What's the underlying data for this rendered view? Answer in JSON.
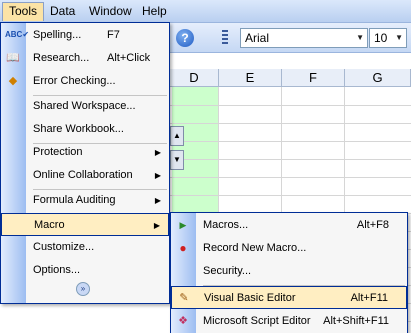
{
  "menubar": {
    "items": [
      {
        "label": "Tools",
        "active": true
      },
      {
        "label": "Data"
      },
      {
        "label": "Window"
      },
      {
        "label": "Help"
      }
    ]
  },
  "toolbar": {
    "help_icon": "?",
    "font_name": "Arial",
    "font_size": "10"
  },
  "grid": {
    "columns": [
      "D",
      "E",
      "F",
      "G"
    ]
  },
  "tools_menu": {
    "items": [
      {
        "label": "Spelling...",
        "shortcut": "F7",
        "icon": "spelling-icon"
      },
      {
        "label": "Research...",
        "shortcut": "Alt+Click",
        "icon": "research-icon"
      },
      {
        "label": "Error Checking...",
        "shortcut": "",
        "icon": "error-checking-icon"
      },
      {
        "label": "Shared Workspace...",
        "shortcut": ""
      },
      {
        "label": "Share Workbook...",
        "shortcut": ""
      },
      {
        "label": "Protection",
        "shortcut": "",
        "submenu": true
      },
      {
        "label": "Online Collaboration",
        "shortcut": "",
        "submenu": true
      },
      {
        "label": "Formula Auditing",
        "shortcut": "",
        "submenu": true
      },
      {
        "label": "Macro",
        "shortcut": "",
        "submenu": true,
        "highlighted": true
      },
      {
        "label": "Customize...",
        "shortcut": ""
      },
      {
        "label": "Options...",
        "shortcut": ""
      }
    ]
  },
  "macro_submenu": {
    "items": [
      {
        "label": "Macros...",
        "shortcut": "Alt+F8",
        "icon": "play-icon"
      },
      {
        "label": "Record New Macro...",
        "shortcut": "",
        "icon": "record-icon"
      },
      {
        "label": "Security...",
        "shortcut": ""
      },
      {
        "label": "Visual Basic Editor",
        "shortcut": "Alt+F11",
        "icon": "vb-editor-icon",
        "highlighted": true
      },
      {
        "label": "Microsoft Script Editor",
        "shortcut": "Alt+Shift+F11",
        "icon": "script-editor-icon"
      }
    ]
  },
  "colors": {
    "menu_border": "#002d96",
    "highlight": "#ffeec2",
    "green_cells": "#ccffcc"
  }
}
